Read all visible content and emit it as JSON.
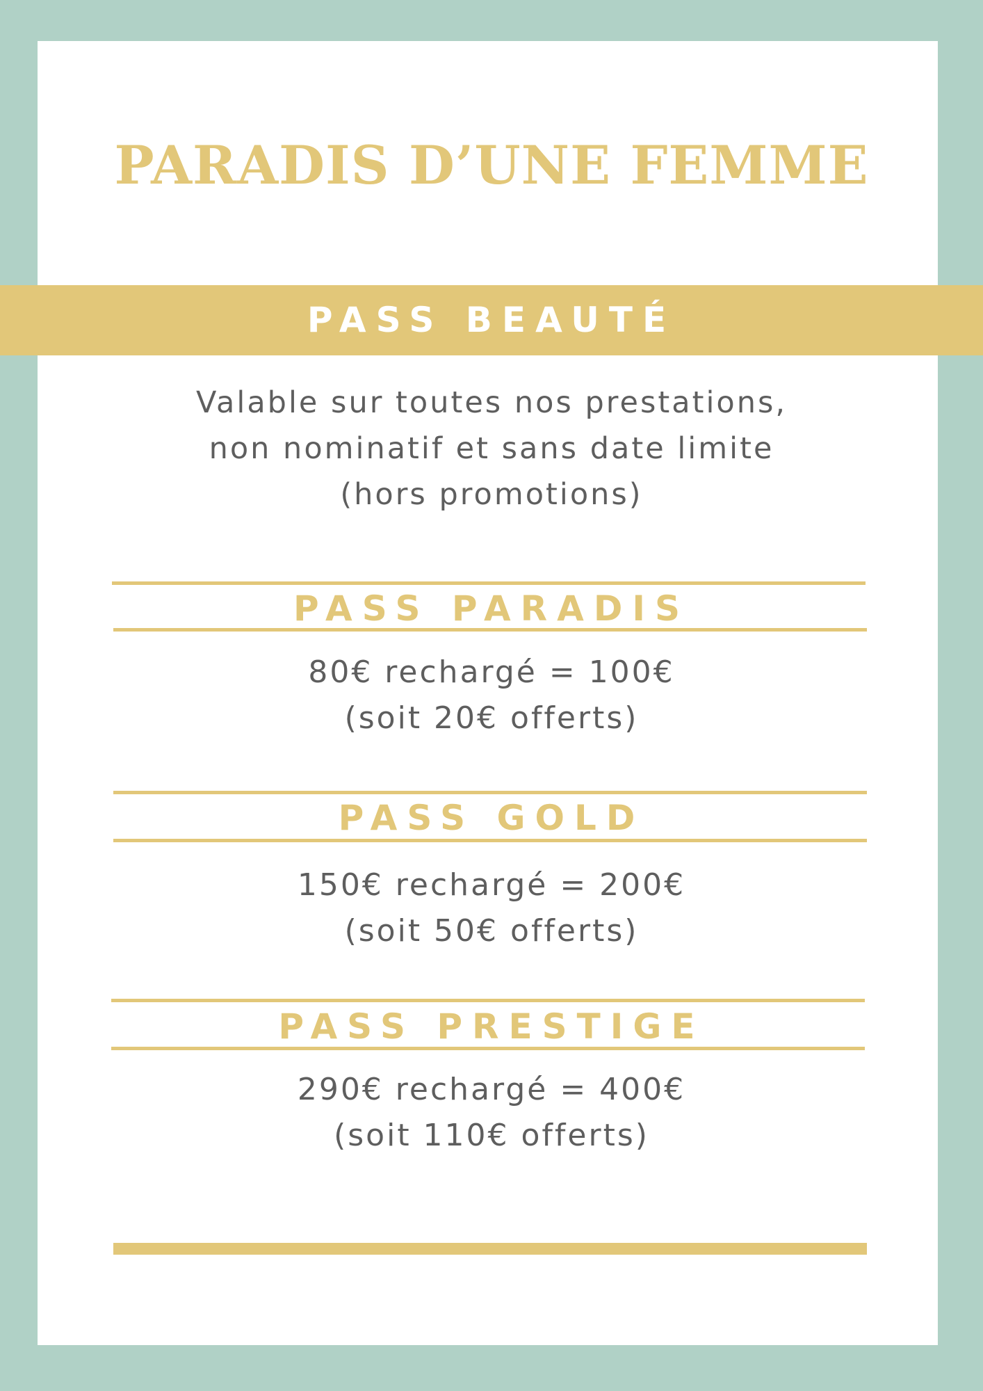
{
  "colors": {
    "frame": "#b0d1c6",
    "gold": "#e2c779",
    "text": "#5e5e5e",
    "card": "#ffffff"
  },
  "title": "PARADIS D’UNE FEMME",
  "banner": "PASS BEAUTÉ",
  "intro": {
    "line1": "Valable sur toutes nos prestations,",
    "line2": "non nominatif et sans date limite",
    "line3": "(hors promotions)"
  },
  "passes": [
    {
      "name": "PASS PARADIS",
      "offer": "80€ rechargé = 100€",
      "bonus": "(soit 20€ offerts)"
    },
    {
      "name": "PASS GOLD",
      "offer": "150€ rechargé = 200€",
      "bonus": "(soit 50€ offerts)"
    },
    {
      "name": "PASS PRESTIGE",
      "offer": "290€ rechargé = 400€",
      "bonus": "(soit 110€ offerts)"
    }
  ]
}
